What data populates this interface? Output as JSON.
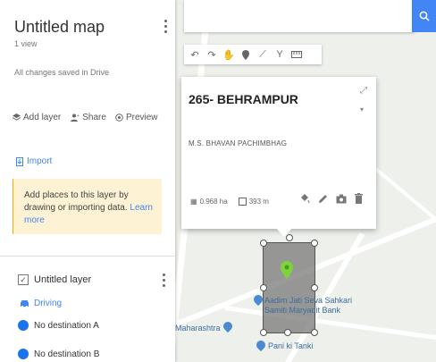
{
  "panel": {
    "title": "Untitled map",
    "views": "1 view",
    "saved_status": "All changes saved in Drive",
    "actions": {
      "add_layer": "Add layer",
      "share": "Share",
      "preview": "Preview"
    },
    "import_label": "Import",
    "tip_text": "Add places to this layer by drawing or importing data.",
    "tip_link": "Learn more",
    "layer2": {
      "name": "Untitled layer",
      "mode": "Driving",
      "dest_a": "No destination A",
      "dest_b": "No destination B"
    }
  },
  "card": {
    "title": "265- BEHRAMPUR",
    "subtitle": "M.S. BHAVAN PACHIMBHAG",
    "area": "0.968 ha",
    "perimeter": "393 m"
  },
  "map_labels": {
    "poi_1": "Aadim Jati Seva Sahkari Samiti Maryadit Bank",
    "poi_2": "Maharashtra",
    "poi_3": "Pani ki Tanki"
  },
  "colors": {
    "accent": "#4285f4",
    "tip_bg": "#fdf3d4",
    "pin": "#7cd33a"
  }
}
